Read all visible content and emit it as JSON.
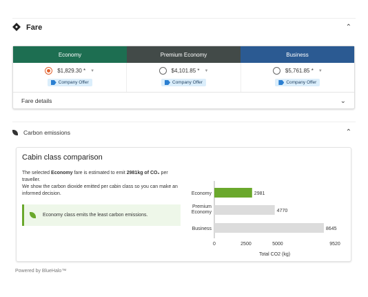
{
  "fare": {
    "title": "Fare",
    "tabs": [
      "Economy",
      "Premium Economy",
      "Business"
    ],
    "options": [
      {
        "price": "$1,829.30 *",
        "selected": true,
        "offer": "Company Offer"
      },
      {
        "price": "$4,101.85 *",
        "selected": false,
        "offer": "Company Offer"
      },
      {
        "price": "$5,761.85 *",
        "selected": false,
        "offer": "Company Offer"
      }
    ],
    "details_label": "Fare details"
  },
  "carbon": {
    "title": "Carbon emissions",
    "card_title": "Cabin class comparison",
    "desc_part1": "The selected ",
    "desc_bold1": "Economy",
    "desc_part2": " fare is estimated to emit ",
    "desc_bold2": "2981kg of CO₂",
    "desc_part3": " per traveller.",
    "desc_line2": "We show the carbon dioxide emitted per cabin class so you can make an informed decision.",
    "info_text": "Economy class emits the least carbon emissions."
  },
  "colors": {
    "economy": "#1d6e51",
    "premium": "#424a48",
    "business": "#2b5a92",
    "highlight_bar": "#6aa82c",
    "bar": "#dcdcdc"
  },
  "chart_data": {
    "type": "bar",
    "orientation": "horizontal",
    "categories": [
      "Economy",
      "Premium Economy",
      "Business"
    ],
    "values": [
      2981,
      4770,
      8645
    ],
    "highlight": "Economy",
    "xlabel": "Total CO2 (kg)",
    "xticks": [
      0,
      2500,
      5000,
      9520
    ],
    "xlim": [
      0,
      9520
    ]
  },
  "footer": {
    "powered": "Powered by BlueHalo™"
  }
}
